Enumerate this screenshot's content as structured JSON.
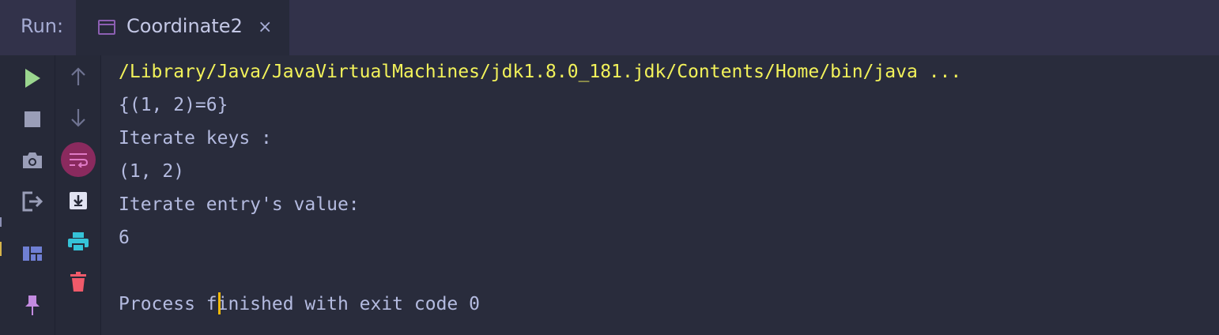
{
  "header": {
    "run_label": "Run:",
    "tab_title": "Coordinate2",
    "tab_close": "×",
    "tab_icon": "window-icon"
  },
  "toolbar": {
    "left": [
      {
        "icon": "run-icon",
        "color": "#9bd68f"
      },
      {
        "icon": "stop-icon",
        "color": "#9a9eb8"
      },
      {
        "icon": "camera-icon",
        "color": "#9a9eb8"
      },
      {
        "icon": "exit-icon",
        "color": "#9a9eb8"
      },
      {
        "icon": "layout-icon",
        "color": "#6f7fd3"
      },
      {
        "icon": "pin-icon",
        "color": "#c38be0"
      }
    ],
    "right": [
      {
        "icon": "arrow-up-icon",
        "color": "#6f7391"
      },
      {
        "icon": "arrow-down-icon",
        "color": "#6f7391"
      },
      {
        "icon": "soft-wrap-icon",
        "color": "#c65fa9",
        "active": true
      },
      {
        "icon": "scroll-to-end-icon",
        "color": "#e1e3f2"
      },
      {
        "icon": "print-icon",
        "color": "#35c3d8"
      },
      {
        "icon": "trash-icon",
        "color": "#f05a6a"
      }
    ]
  },
  "console": {
    "lines": [
      "/Library/Java/JavaVirtualMachines/jdk1.8.0_181.jdk/Contents/Home/bin/java ...",
      "{(1, 2)=6}",
      "Iterate keys :",
      "(1, 2)",
      "Iterate entry's value:",
      "6",
      "",
      "Process finished with exit code 0"
    ]
  }
}
